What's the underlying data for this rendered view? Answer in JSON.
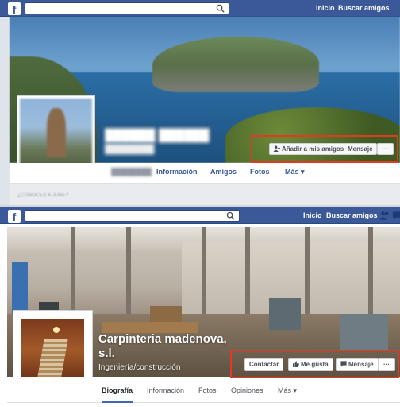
{
  "top": {
    "navbar": {
      "logo": "f",
      "search_placeholder": "",
      "links": [
        "Inicio",
        "Buscar amigos"
      ]
    },
    "tabs": [
      "Información",
      "Amigos",
      "Fotos",
      "Más ▾"
    ],
    "actions": {
      "add_friend": "Añadir a mis amigos",
      "message": "Mensaje",
      "more": "···"
    }
  },
  "bottom": {
    "navbar": {
      "logo": "f",
      "search_placeholder": "",
      "links": [
        "Inicio",
        "Buscar amigos"
      ]
    },
    "page": {
      "name_line1": "Carpinteria madenova,",
      "name_line2": "s.l.",
      "category": "Ingeniería/construcción"
    },
    "tabs": [
      "Biografía",
      "Información",
      "Fotos",
      "Opiniones",
      "Más ▾"
    ],
    "actions": {
      "contact": "Contactar",
      "like": "Me gusta",
      "message": "Mensaje",
      "more": "···"
    }
  },
  "colors": {
    "fb_blue": "#3b5998",
    "highlight_red": "#e2391f",
    "link_blue": "#365899"
  }
}
